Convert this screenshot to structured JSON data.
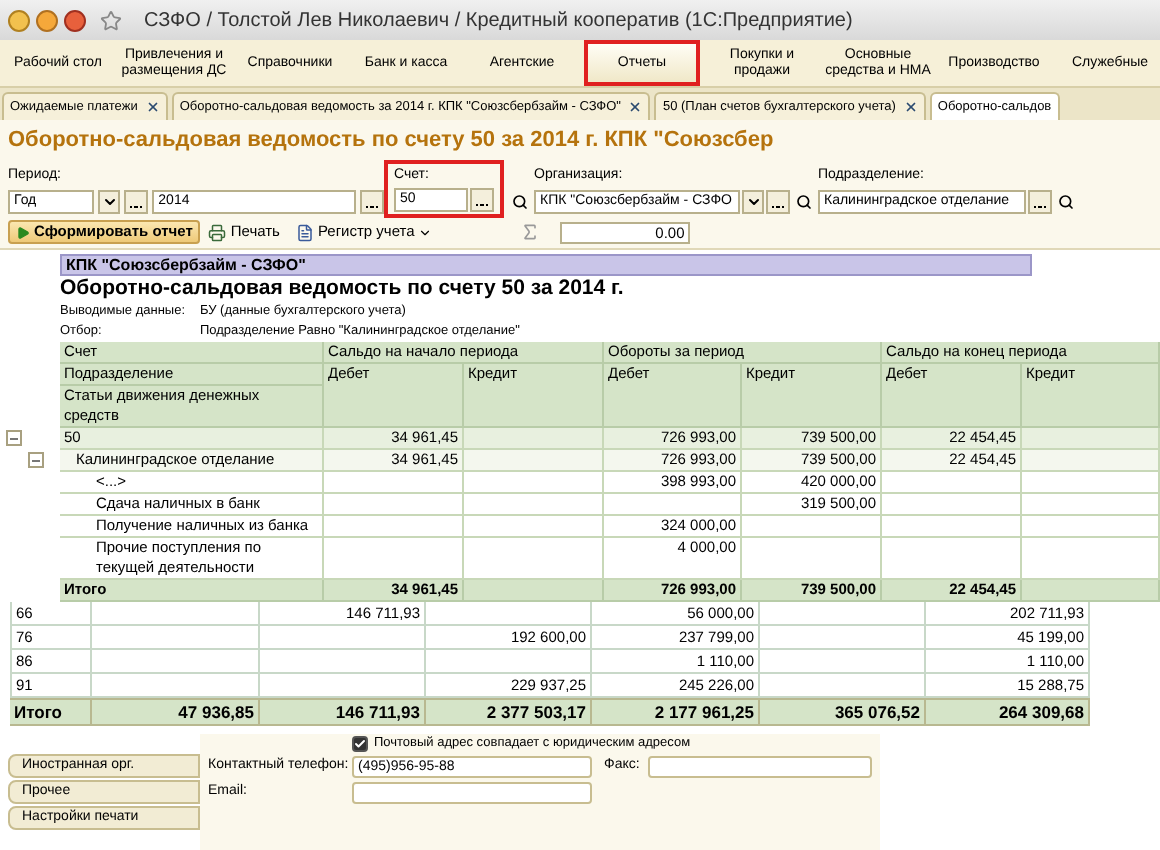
{
  "window": {
    "title": "СЗФО / Толстой Лев Николаевич / Кредитный кооператив (1С:Предприятие)"
  },
  "sections": [
    {
      "label": "Рабочий стол",
      "selected": false
    },
    {
      "label": "Привлечения и размещения ДС",
      "selected": false
    },
    {
      "label": "Справочники",
      "selected": false
    },
    {
      "label": "Банк и касса",
      "selected": false
    },
    {
      "label": "Агентские",
      "selected": false
    },
    {
      "label": "Отчеты",
      "selected": true
    },
    {
      "label": "Покупки и продажи",
      "selected": false
    },
    {
      "label": "Основные средства и НМА",
      "selected": false
    },
    {
      "label": "Производство",
      "selected": false
    },
    {
      "label": "Служебные",
      "selected": false
    }
  ],
  "open_tabs": [
    {
      "label": "Ожидаемые платежи",
      "selected": false
    },
    {
      "label": "Оборотно-сальдовая ведомость за 2014 г. КПК \"Союзсбербзайм - СЗФО\"",
      "selected": false
    },
    {
      "label": "50 (План счетов бухгалтерского учета)",
      "selected": false
    },
    {
      "label": "Оборотно-сальдов",
      "selected": true
    }
  ],
  "report_title": "Оборотно-сальдовая ведомость по счету 50 за 2014 г. КПК \"Союзсбер",
  "filters": {
    "period": {
      "label": "Период:",
      "kind": "Год",
      "year": "2014"
    },
    "account": {
      "label": "Счет:",
      "value": "50"
    },
    "organization": {
      "label": "Организация:",
      "value": "КПК \"Союзсбербзайм - СЗФО"
    },
    "division": {
      "label": "Подразделение:",
      "value": "Калининградское отделание"
    }
  },
  "toolbar": {
    "generate": "Сформировать отчет",
    "print": "Печать",
    "register": "Регистр учета",
    "sum": "0.00"
  },
  "report": {
    "organization": "КПК \"Союзсбербзайм - СЗФО\"",
    "title": "Оборотно-сальдовая ведомость по счету 50 за 2014 г.",
    "meta": [
      {
        "label": "Выводимые данные:",
        "value": "БУ (данные бухгалтерского учета)"
      },
      {
        "label": "Отбор:",
        "value": "Подразделение Равно \"Калининградское отделание\""
      }
    ],
    "row_headers": [
      "Счет",
      "Подразделение",
      "Статьи движения денежных средств"
    ],
    "groups": [
      {
        "label": "Сальдо на начало периода",
        "sub": [
          "Дебет",
          "Кредит"
        ]
      },
      {
        "label": "Обороты за период",
        "sub": [
          "Дебет",
          "Кредит"
        ]
      },
      {
        "label": "Сальдо на конец периода",
        "sub": [
          "Дебет",
          "Кредит"
        ]
      }
    ],
    "rows": [
      {
        "account": "50",
        "values": {
          "opening_debit": "34 961,45",
          "turnover_debit": "726 993,00",
          "turnover_credit": "739 500,00",
          "closing_debit": "22 454,45"
        },
        "expanded": true,
        "children": [
          {
            "account": "Калининградское отделание",
            "values": {
              "opening_debit": "34 961,45",
              "turnover_debit": "726 993,00",
              "turnover_credit": "739 500,00",
              "closing_debit": "22 454,45"
            },
            "expanded": true,
            "children": [
              {
                "account": "<...>",
                "values": {
                  "turnover_debit": "398 993,00",
                  "turnover_credit": "420 000,00"
                }
              },
              {
                "account": "Сдача наличных в банк",
                "values": {
                  "turnover_credit": "319 500,00"
                }
              },
              {
                "account": "Получение наличных из банка",
                "values": {
                  "turnover_debit": "324 000,00"
                }
              },
              {
                "account": "Прочие поступления по текущей деятельности",
                "values": {
                  "turnover_debit": "4 000,00"
                }
              }
            ]
          }
        ]
      }
    ],
    "total": {
      "label": "Итого",
      "values": {
        "opening_debit": "34 961,45",
        "turnover_debit": "726 993,00",
        "turnover_credit": "739 500,00",
        "closing_debit": "22 454,45"
      }
    }
  },
  "lower_table": {
    "rows": [
      {
        "column_1": "66",
        "column_3": "146 711,93",
        "column_5": "56 000,00",
        "column_7": "202 711,93"
      },
      {
        "column_1": "76",
        "column_4": "192 600,00",
        "column_5": "237 799,00",
        "column_7": "45 199,00"
      },
      {
        "column_1": "86",
        "column_5": "1 110,00",
        "column_7": "1 110,00"
      },
      {
        "column_1": "91",
        "column_4": "229 937,25",
        "column_5": "245 226,00",
        "column_7": "15 288,75"
      }
    ],
    "total": {
      "column_1": "Итого",
      "column_2": "47 936,85",
      "column_3": "146 711,93",
      "column_4": "2 377 503,17",
      "column_5": "2 177 961,25",
      "column_6": "365 076,52",
      "column_7": "264 309,68"
    }
  },
  "contact_form": {
    "side_tabs": [
      "Иностранная орг.",
      "Прочее",
      "Настройки печати"
    ],
    "address_checkbox": {
      "label": "Почтовый адрес совпадает с юридическим адресом",
      "checked": true
    },
    "phone": {
      "label": "Контактный телефон:",
      "value": "(495)956-95-88"
    },
    "fax": {
      "label": "Факс:"
    },
    "email": {
      "label": "Email:"
    }
  }
}
